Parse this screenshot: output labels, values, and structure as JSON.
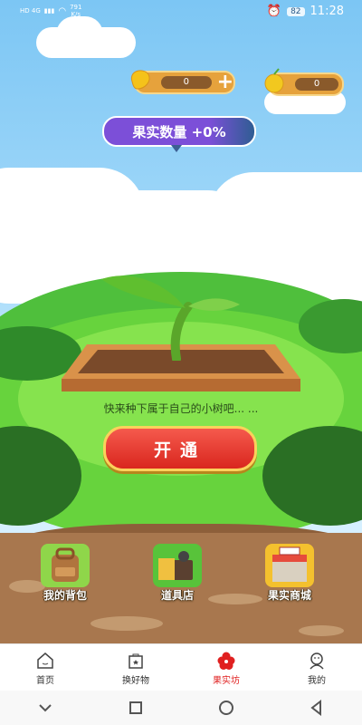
{
  "status_bar": {
    "signal_left": "HD 4G",
    "net_speed": "791",
    "net_unit": "K/s",
    "battery": "82",
    "time": "11:28"
  },
  "counters": {
    "fruit_count": "0",
    "coin_count": "0"
  },
  "boost_pill": {
    "label": "果实数量 +0%"
  },
  "tip_text": "快来种下属于自己的小树吧... ...",
  "cta": {
    "label": "开通"
  },
  "game_buttons": [
    {
      "label": "我的背包",
      "icon": "backpack-icon"
    },
    {
      "label": "道具店",
      "icon": "shop-icon"
    },
    {
      "label": "果实商城",
      "icon": "store-icon"
    }
  ],
  "tabs": [
    {
      "label": "首页",
      "icon": "home-icon",
      "active": false
    },
    {
      "label": "换好物",
      "icon": "bag-icon",
      "active": false
    },
    {
      "label": "果实坊",
      "icon": "flower-icon",
      "active": true
    },
    {
      "label": "我的",
      "icon": "user-icon",
      "active": false
    }
  ],
  "colors": {
    "active_tab": "#e02020",
    "cta_red": "#e43a30",
    "sky": "#7cc6f4",
    "grass": "#67d33d"
  }
}
